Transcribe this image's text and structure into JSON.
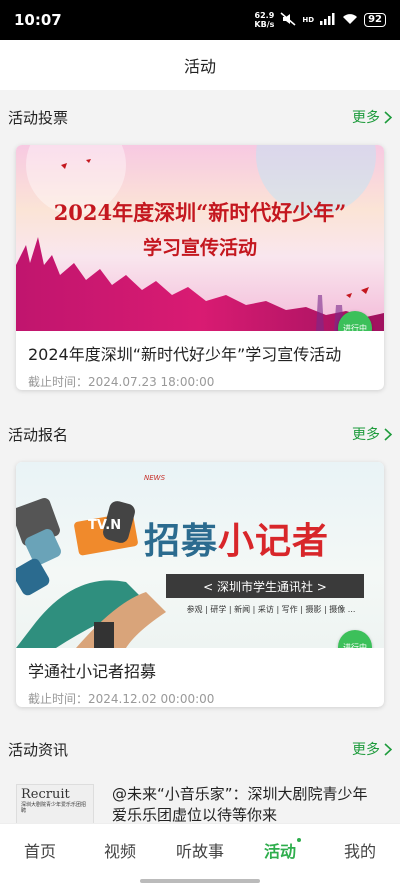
{
  "status_bar": {
    "time": "10:07",
    "net_speed_value": "62.9",
    "net_speed_unit": "KB/s",
    "network": "HD",
    "battery": "92"
  },
  "header": {
    "title": "活动"
  },
  "sections": {
    "vote": {
      "title": "活动投票",
      "more": "更多",
      "card": {
        "banner_line1": "2024年度深圳“新时代好少年”",
        "banner_line2": "学习宣传活动",
        "title": "2024年度深圳“新时代好少年”学习宣传活动",
        "deadline": "截止时间：2024.07.23 18:00:00",
        "status": "进行中"
      }
    },
    "signup": {
      "title": "活动报名",
      "more": "更多",
      "card": {
        "banner_news": "NEWS",
        "banner_big_a": "招募",
        "banner_big_b": "小记者",
        "banner_bar": "< 深圳市学生通讯社 >",
        "banner_sub": "参观 | 研学 | 新闻 | 采访 | 写作 | 摄影 | 摄像 ...",
        "banner_tv": "TV.N",
        "title": "学通社小记者招募",
        "deadline": "截止时间：2024.12.02 00:00:00",
        "status": "进行中"
      }
    },
    "news": {
      "title": "活动资讯",
      "more": "更多",
      "items": [
        {
          "thumb_title": "Recruit",
          "thumb_text": "深圳大剧院青少年爱乐乐团招聘",
          "text": "@未来“小音乐家”：深圳大剧院青少年爱乐乐团虚位以待等你来"
        }
      ]
    }
  },
  "tabs": [
    {
      "label": "首页",
      "active": false
    },
    {
      "label": "视频",
      "active": false
    },
    {
      "label": "听故事",
      "active": false
    },
    {
      "label": "活动",
      "active": true
    },
    {
      "label": "我的",
      "active": false
    }
  ],
  "colors": {
    "accent": "#2fae4d",
    "more": "#1e9b3c",
    "badge": "#3cc05a",
    "banner_red": "#c4171f"
  }
}
